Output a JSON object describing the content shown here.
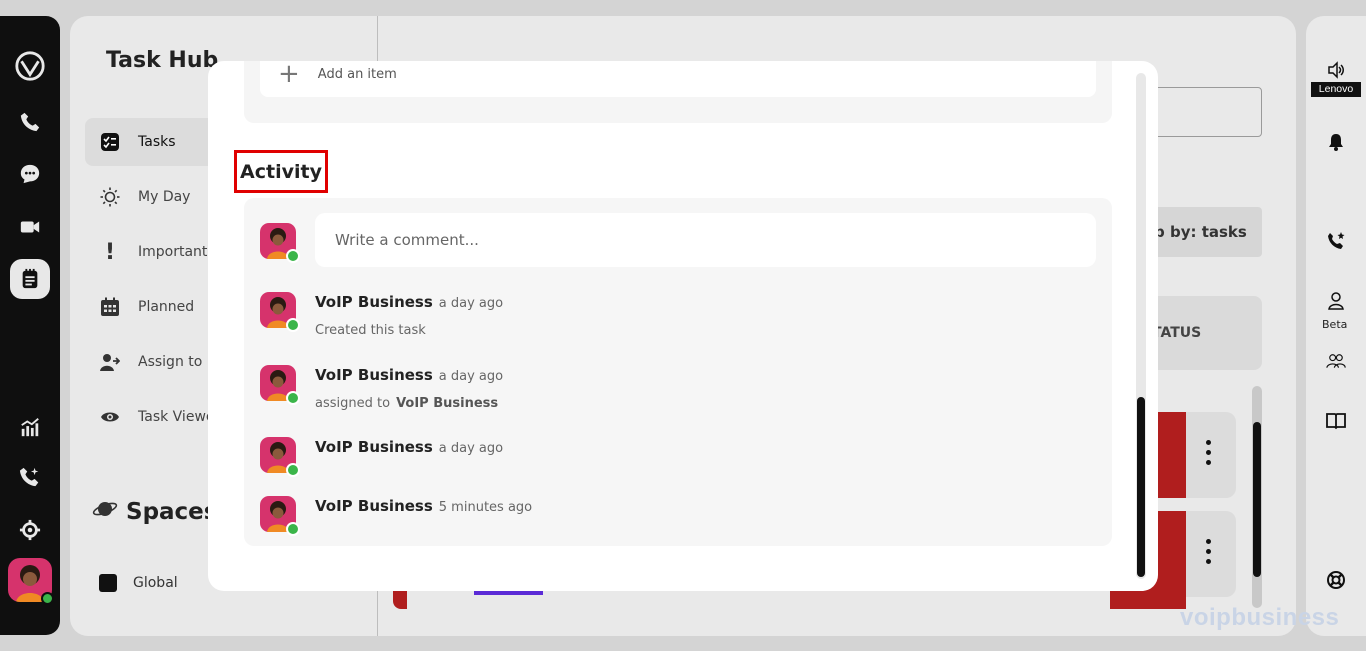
{
  "left_rail": {
    "icons": [
      "logo-icon",
      "phone-icon",
      "chat-icon",
      "video-icon",
      "notes-icon",
      "analytics-icon",
      "call-sparkle-icon",
      "gear-icon"
    ]
  },
  "sidebar": {
    "title": "Task Hub",
    "items": [
      {
        "label": "Tasks",
        "icon": "checklist-icon",
        "active": true
      },
      {
        "label": "My Day",
        "icon": "sun-icon"
      },
      {
        "label": "Important",
        "icon": "exclamation-icon"
      },
      {
        "label": "Planned",
        "icon": "calendar-icon"
      },
      {
        "label": "Assign to m",
        "icon": "assign-user-icon"
      },
      {
        "label": "Task Viewe",
        "icon": "eye-icon"
      }
    ],
    "spaces_label": "Spaces",
    "global_label": "Global"
  },
  "background": {
    "group_by": "p by: tasks",
    "status_header": "TATUS",
    "watermark": "voipbusiness"
  },
  "right_rail": {
    "lenovo": "Lenovo",
    "beta": "Beta"
  },
  "modal": {
    "add_item_label": "Add an item",
    "activity_title": "Activity",
    "comment_placeholder": "Write a comment...",
    "entries": [
      {
        "name": "VoIP Business",
        "time": "a day ago",
        "detail": "Created this task",
        "target": ""
      },
      {
        "name": "VoIP Business",
        "time": "a day ago",
        "detail": "assigned to",
        "target": "VoIP Business"
      },
      {
        "name": "VoIP Business",
        "time": "a day ago",
        "detail": "",
        "target": ""
      },
      {
        "name": "VoIP Business",
        "time": "5 minutes ago",
        "detail": "",
        "target": ""
      }
    ]
  },
  "colors": {
    "accent_red": "#e00000",
    "avatar_pink": "#d6336c",
    "online_green": "#3bb54a",
    "status_red": "#b01e1e"
  }
}
